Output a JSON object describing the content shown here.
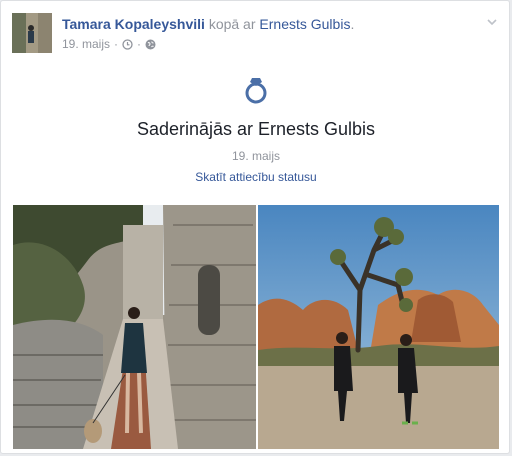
{
  "post": {
    "author": "Tamara Kopaleyshvili",
    "with_text": "kopā ar",
    "friend": "Ernests Gulbis",
    "period": ".",
    "date": "19. maijs",
    "dot": "·"
  },
  "event": {
    "title": "Saderinājās ar Ernests Gulbis",
    "date": "19. maijs",
    "link": "Skatīt attiecību statusu"
  },
  "icons": {
    "menu": "chevron-down-icon",
    "clock": "clock-icon",
    "privacy": "globe-icon",
    "event": "engagement-ring-icon"
  },
  "colors": {
    "link": "#365899",
    "event_icon": "#4b6fa7",
    "muted": "#90949c"
  }
}
